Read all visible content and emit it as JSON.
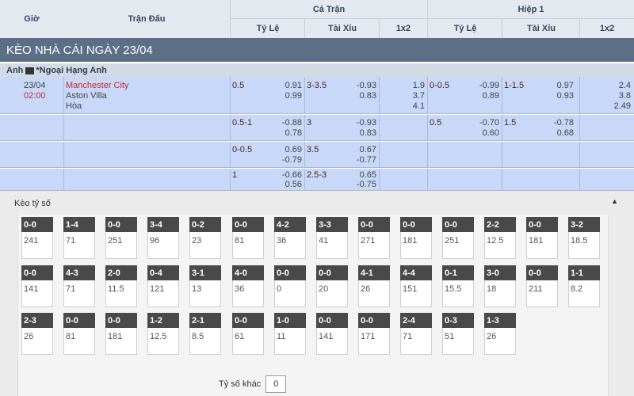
{
  "header": {
    "gio": "Giờ",
    "tran_dau": "Trận Đấu",
    "ca_tran": "Cả Trận",
    "hiep1": "Hiệp 1",
    "ty_le": "Tỷ Lệ",
    "tai_xiu": "Tài Xỉu",
    "x12": "1x2",
    "ty_le_h1": "Tỷ Lệ",
    "tai_xiu_h1": "Tài Xỉu",
    "x12_h1": "1x2"
  },
  "day_title": "KÈO NHÀ CÁI NGÀY 23/04",
  "league": {
    "country": "Anh",
    "name": "*Ngoại Hạng Anh"
  },
  "match": {
    "date": "23/04",
    "time": "02:00",
    "home": "Manchester City",
    "away": "Aston Villa",
    "draw": "Hòa"
  },
  "odds_rows": [
    {
      "hdp": "0.5",
      "hdp_home": "0.91",
      "hdp_away": "0.99",
      "ou": "3-3.5",
      "ou_over": "-0.93",
      "ou_under": "0.83",
      "x12": [
        "1.9",
        "3.7",
        "4.1"
      ],
      "h1_hdp": "0-0.5",
      "h1_hdp_home": "-0.99",
      "h1_hdp_away": "0.89",
      "h1_ou": "1-1.5",
      "h1_ou_over": "0.97",
      "h1_ou_under": "0.93",
      "h1_x12": [
        "2.4",
        "3.8",
        "2.49"
      ]
    },
    {
      "hdp": "0.5-1",
      "hdp_home": "-0.88",
      "hdp_away": "0.78",
      "ou": "3",
      "ou_over": "-0.93",
      "ou_under": "0.83",
      "h1_hdp": "0.5",
      "h1_hdp_home": "-0.70",
      "h1_hdp_away": "0.60",
      "h1_ou": "1.5",
      "h1_ou_over": "-0.78",
      "h1_ou_under": "0.68"
    },
    {
      "hdp": "0-0.5",
      "hdp_home": "0.69",
      "hdp_away": "-0.79",
      "ou": "3.5",
      "ou_over": "0.67",
      "ou_under": "-0.77"
    },
    {
      "hdp": "1",
      "hdp_home": "-0.66",
      "hdp_away": "0.56",
      "ou": "2.5-3",
      "ou_over": "0.65",
      "ou_under": "-0.75"
    }
  ],
  "correct_score": {
    "title": "Kèo tỷ số",
    "rows": [
      [
        {
          "s": "0-0",
          "v": "241"
        },
        {
          "s": "1-4",
          "v": "71"
        },
        {
          "s": "0-0",
          "v": "251"
        },
        {
          "s": "3-4",
          "v": "96"
        },
        {
          "s": "0-2",
          "v": "23"
        },
        {
          "s": "0-0",
          "v": "81"
        },
        {
          "s": "4-2",
          "v": "36"
        },
        {
          "s": "3-3",
          "v": "41"
        },
        {
          "s": "0-0",
          "v": "271"
        },
        {
          "s": "0-0",
          "v": "181"
        },
        {
          "s": "0-0",
          "v": "251"
        },
        {
          "s": "2-2",
          "v": "12.5"
        },
        {
          "s": "0-0",
          "v": "181"
        },
        {
          "s": "3-2",
          "v": "18.5"
        }
      ],
      [
        {
          "s": "0-0",
          "v": "141"
        },
        {
          "s": "4-3",
          "v": "71"
        },
        {
          "s": "2-0",
          "v": "11.5"
        },
        {
          "s": "0-4",
          "v": "121"
        },
        {
          "s": "3-1",
          "v": "13"
        },
        {
          "s": "4-0",
          "v": "36"
        },
        {
          "s": "0-0",
          "v": "0"
        },
        {
          "s": "0-0",
          "v": "20"
        },
        {
          "s": "4-1",
          "v": "26"
        },
        {
          "s": "4-4",
          "v": "151"
        },
        {
          "s": "0-1",
          "v": "15.5"
        },
        {
          "s": "3-0",
          "v": "18"
        },
        {
          "s": "0-0",
          "v": "211"
        },
        {
          "s": "1-1",
          "v": "8.2"
        }
      ],
      [
        {
          "s": "2-3",
          "v": "26"
        },
        {
          "s": "0-0",
          "v": "81"
        },
        {
          "s": "0-0",
          "v": "181"
        },
        {
          "s": "1-2",
          "v": "12.5"
        },
        {
          "s": "2-1",
          "v": "8.5"
        },
        {
          "s": "0-0",
          "v": "61"
        },
        {
          "s": "1-0",
          "v": "11"
        },
        {
          "s": "0-0",
          "v": "141"
        },
        {
          "s": "0-0",
          "v": "171"
        },
        {
          "s": "2-4",
          "v": "71"
        },
        {
          "s": "0-3",
          "v": "51"
        },
        {
          "s": "1-3",
          "v": "26"
        }
      ]
    ],
    "other_label": "Tỷ số khác",
    "other_value": "0",
    "collapse_icon": "triangle-up-icon"
  }
}
